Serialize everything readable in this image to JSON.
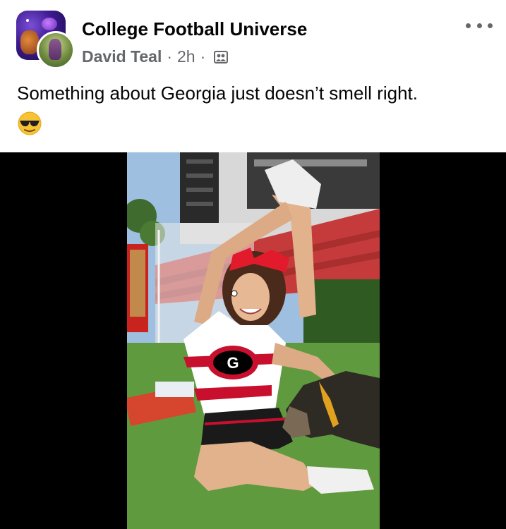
{
  "post": {
    "group_name": "College Football Universe",
    "author": "David Teal",
    "separator": "·",
    "time": "2h",
    "audience_icon": "group-audience-icon",
    "more_icon": "more-options-icon",
    "text": "Something about Georgia just doesn’t smell right.",
    "emoji": "😎"
  },
  "colors": {
    "primary_text": "#050505",
    "secondary_text": "#65676b",
    "background": "#ffffff",
    "media_background": "#000000",
    "georgia_red": "#ba0c2f"
  }
}
